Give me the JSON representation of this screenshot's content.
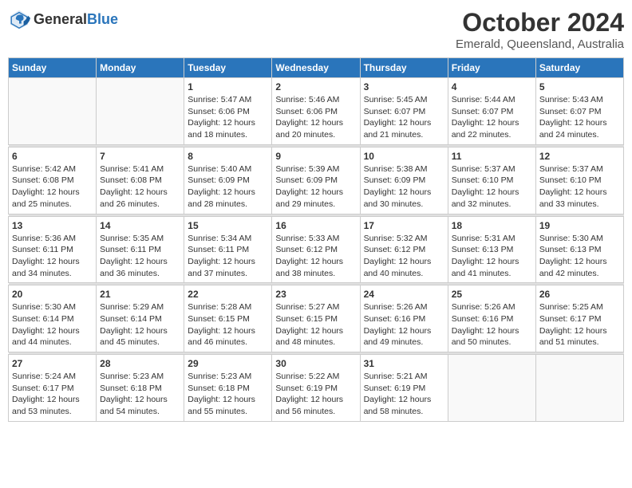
{
  "header": {
    "logo_general": "General",
    "logo_blue": "Blue",
    "month": "October 2024",
    "location": "Emerald, Queensland, Australia"
  },
  "weekdays": [
    "Sunday",
    "Monday",
    "Tuesday",
    "Wednesday",
    "Thursday",
    "Friday",
    "Saturday"
  ],
  "weeks": [
    [
      {
        "day": "",
        "detail": ""
      },
      {
        "day": "",
        "detail": ""
      },
      {
        "day": "1",
        "detail": "Sunrise: 5:47 AM\nSunset: 6:06 PM\nDaylight: 12 hours and 18 minutes."
      },
      {
        "day": "2",
        "detail": "Sunrise: 5:46 AM\nSunset: 6:06 PM\nDaylight: 12 hours and 20 minutes."
      },
      {
        "day": "3",
        "detail": "Sunrise: 5:45 AM\nSunset: 6:07 PM\nDaylight: 12 hours and 21 minutes."
      },
      {
        "day": "4",
        "detail": "Sunrise: 5:44 AM\nSunset: 6:07 PM\nDaylight: 12 hours and 22 minutes."
      },
      {
        "day": "5",
        "detail": "Sunrise: 5:43 AM\nSunset: 6:07 PM\nDaylight: 12 hours and 24 minutes."
      }
    ],
    [
      {
        "day": "6",
        "detail": "Sunrise: 5:42 AM\nSunset: 6:08 PM\nDaylight: 12 hours and 25 minutes."
      },
      {
        "day": "7",
        "detail": "Sunrise: 5:41 AM\nSunset: 6:08 PM\nDaylight: 12 hours and 26 minutes."
      },
      {
        "day": "8",
        "detail": "Sunrise: 5:40 AM\nSunset: 6:09 PM\nDaylight: 12 hours and 28 minutes."
      },
      {
        "day": "9",
        "detail": "Sunrise: 5:39 AM\nSunset: 6:09 PM\nDaylight: 12 hours and 29 minutes."
      },
      {
        "day": "10",
        "detail": "Sunrise: 5:38 AM\nSunset: 6:09 PM\nDaylight: 12 hours and 30 minutes."
      },
      {
        "day": "11",
        "detail": "Sunrise: 5:37 AM\nSunset: 6:10 PM\nDaylight: 12 hours and 32 minutes."
      },
      {
        "day": "12",
        "detail": "Sunrise: 5:37 AM\nSunset: 6:10 PM\nDaylight: 12 hours and 33 minutes."
      }
    ],
    [
      {
        "day": "13",
        "detail": "Sunrise: 5:36 AM\nSunset: 6:11 PM\nDaylight: 12 hours and 34 minutes."
      },
      {
        "day": "14",
        "detail": "Sunrise: 5:35 AM\nSunset: 6:11 PM\nDaylight: 12 hours and 36 minutes."
      },
      {
        "day": "15",
        "detail": "Sunrise: 5:34 AM\nSunset: 6:11 PM\nDaylight: 12 hours and 37 minutes."
      },
      {
        "day": "16",
        "detail": "Sunrise: 5:33 AM\nSunset: 6:12 PM\nDaylight: 12 hours and 38 minutes."
      },
      {
        "day": "17",
        "detail": "Sunrise: 5:32 AM\nSunset: 6:12 PM\nDaylight: 12 hours and 40 minutes."
      },
      {
        "day": "18",
        "detail": "Sunrise: 5:31 AM\nSunset: 6:13 PM\nDaylight: 12 hours and 41 minutes."
      },
      {
        "day": "19",
        "detail": "Sunrise: 5:30 AM\nSunset: 6:13 PM\nDaylight: 12 hours and 42 minutes."
      }
    ],
    [
      {
        "day": "20",
        "detail": "Sunrise: 5:30 AM\nSunset: 6:14 PM\nDaylight: 12 hours and 44 minutes."
      },
      {
        "day": "21",
        "detail": "Sunrise: 5:29 AM\nSunset: 6:14 PM\nDaylight: 12 hours and 45 minutes."
      },
      {
        "day": "22",
        "detail": "Sunrise: 5:28 AM\nSunset: 6:15 PM\nDaylight: 12 hours and 46 minutes."
      },
      {
        "day": "23",
        "detail": "Sunrise: 5:27 AM\nSunset: 6:15 PM\nDaylight: 12 hours and 48 minutes."
      },
      {
        "day": "24",
        "detail": "Sunrise: 5:26 AM\nSunset: 6:16 PM\nDaylight: 12 hours and 49 minutes."
      },
      {
        "day": "25",
        "detail": "Sunrise: 5:26 AM\nSunset: 6:16 PM\nDaylight: 12 hours and 50 minutes."
      },
      {
        "day": "26",
        "detail": "Sunrise: 5:25 AM\nSunset: 6:17 PM\nDaylight: 12 hours and 51 minutes."
      }
    ],
    [
      {
        "day": "27",
        "detail": "Sunrise: 5:24 AM\nSunset: 6:17 PM\nDaylight: 12 hours and 53 minutes."
      },
      {
        "day": "28",
        "detail": "Sunrise: 5:23 AM\nSunset: 6:18 PM\nDaylight: 12 hours and 54 minutes."
      },
      {
        "day": "29",
        "detail": "Sunrise: 5:23 AM\nSunset: 6:18 PM\nDaylight: 12 hours and 55 minutes."
      },
      {
        "day": "30",
        "detail": "Sunrise: 5:22 AM\nSunset: 6:19 PM\nDaylight: 12 hours and 56 minutes."
      },
      {
        "day": "31",
        "detail": "Sunrise: 5:21 AM\nSunset: 6:19 PM\nDaylight: 12 hours and 58 minutes."
      },
      {
        "day": "",
        "detail": ""
      },
      {
        "day": "",
        "detail": ""
      }
    ]
  ]
}
